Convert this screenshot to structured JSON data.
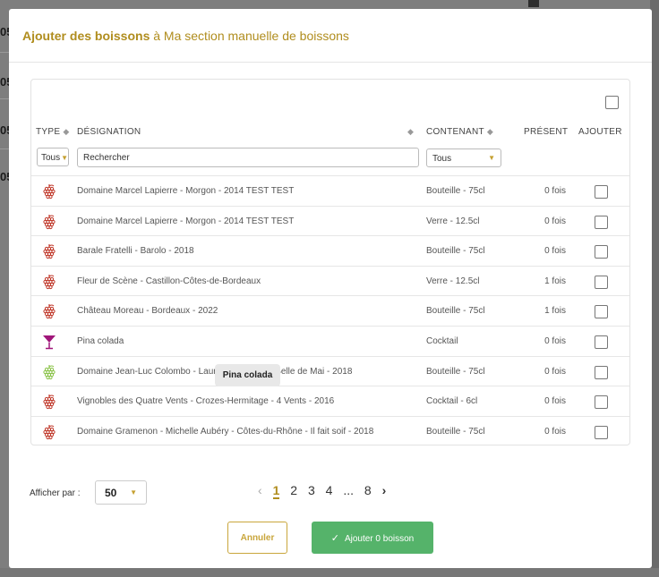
{
  "background": {
    "numbers": [
      "05",
      "05",
      "05",
      "05"
    ]
  },
  "modal": {
    "title_strong": "Ajouter des boissons",
    "title_rest": " à Ma section manuelle de boissons"
  },
  "columns": {
    "type": "TYPE",
    "designation": "DÉSIGNATION",
    "contenant": "CONTENANT",
    "present": "PRÉSENT",
    "ajouter": "AJOUTER"
  },
  "filters": {
    "type_value": "Tous",
    "search_placeholder": "Rechercher",
    "contenant_value": "Tous"
  },
  "rows": [
    {
      "icon": "grape-icon",
      "color": "#c0392b",
      "name": "Domaine Marcel Lapierre - Morgon - 2014 TEST TEST",
      "contenant": "Bouteille - 75cl",
      "present": "0 fois"
    },
    {
      "icon": "grape-icon",
      "color": "#c0392b",
      "name": "Domaine Marcel Lapierre - Morgon - 2014 TEST TEST",
      "contenant": "Verre - 12.5cl",
      "present": "0 fois"
    },
    {
      "icon": "grape-icon",
      "color": "#c0392b",
      "name": "Barale Fratelli - Barolo - 2018",
      "contenant": "Bouteille - 75cl",
      "present": "0 fois"
    },
    {
      "icon": "grape-icon",
      "color": "#c0392b",
      "name": "Fleur de Scène - Castillon-Côtes-de-Bordeaux",
      "contenant": "Verre - 12.5cl",
      "present": "1 fois"
    },
    {
      "icon": "grape-icon",
      "color": "#c0392b",
      "name": "Château Moreau - Bordeaux - 2022",
      "contenant": "Bouteille - 75cl",
      "present": "1 fois"
    },
    {
      "icon": "cocktail-icon",
      "color": "#a0167a",
      "name": "Pina colada",
      "contenant": "Cocktail",
      "present": "0 fois"
    },
    {
      "icon": "grape-icon",
      "color": "#8bc34a",
      "name": "Domaine Jean-Luc Colombo - Laur                      int-Péray - La Belle de Mai - 2018",
      "contenant": "Bouteille - 75cl",
      "present": "0 fois"
    },
    {
      "icon": "grape-icon",
      "color": "#c0392b",
      "name": "Vignobles des Quatre Vents - Crozes-Hermitage - 4 Vents - 2016",
      "contenant": "Cocktail - 6cl",
      "present": "0 fois"
    },
    {
      "icon": "grape-icon",
      "color": "#c0392b",
      "name": "Domaine Gramenon - Michelle Aubéry - Côtes-du-Rhône - Il fait soif - 2018",
      "contenant": "Bouteille - 75cl",
      "present": "0 fois"
    }
  ],
  "tooltip": "Pina colada",
  "pagination": {
    "per_page_label": "Afficher par :",
    "per_page_value": "50",
    "prev": "‹",
    "pages": [
      "1",
      "2",
      "3",
      "4"
    ],
    "ellipsis": "...",
    "last": "8",
    "next": "›"
  },
  "actions": {
    "cancel": "Annuler",
    "add": "Ajouter 0 boisson"
  },
  "colors": {
    "accent": "#b08d1e",
    "success": "#55b36a"
  }
}
